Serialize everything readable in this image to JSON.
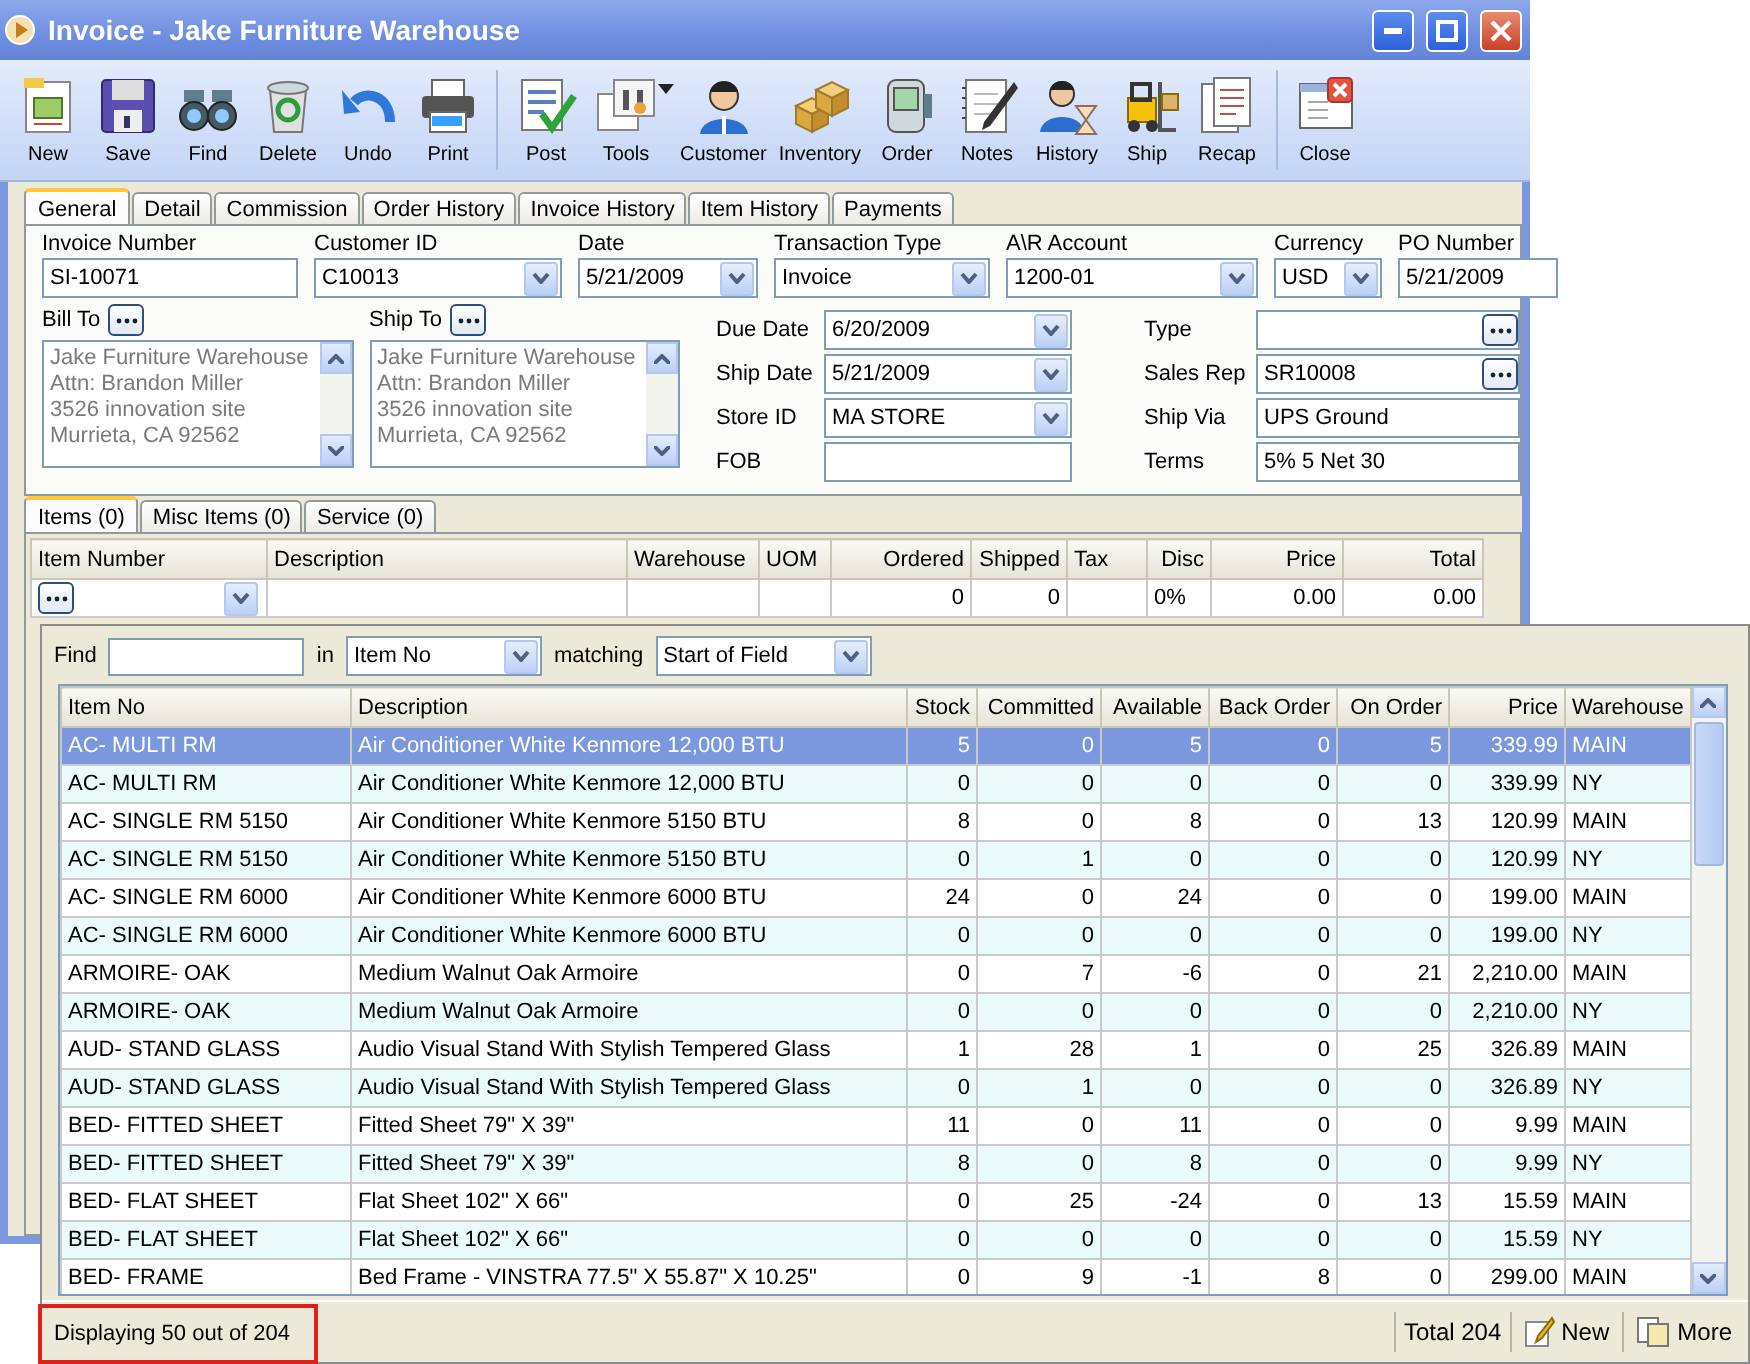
{
  "window": {
    "title": "Invoice - Jake Furniture Warehouse"
  },
  "toolbar": [
    [
      {
        "label": "New"
      },
      {
        "label": "Save"
      },
      {
        "label": "Find"
      },
      {
        "label": "Delete"
      },
      {
        "label": "Undo"
      },
      {
        "label": "Print"
      }
    ],
    [
      {
        "label": "Post"
      },
      {
        "label": "Tools",
        "has_menu": true
      },
      {
        "label": "Customer"
      },
      {
        "label": "Inventory"
      },
      {
        "label": "Order"
      },
      {
        "label": "Notes"
      },
      {
        "label": "History"
      },
      {
        "label": "Ship"
      },
      {
        "label": "Recap"
      }
    ],
    [
      {
        "label": "Close"
      }
    ]
  ],
  "tabs": [
    {
      "label": "General",
      "selected": true
    },
    {
      "label": "Detail",
      "selected": false
    },
    {
      "label": "Commission",
      "selected": false
    },
    {
      "label": "Order History",
      "selected": false
    },
    {
      "label": "Invoice History",
      "selected": false
    },
    {
      "label": "Item History",
      "selected": false
    },
    {
      "label": "Payments",
      "selected": false
    }
  ],
  "header_fields": [
    {
      "label": "Invoice Number",
      "value": "SI-10071",
      "kind": "text"
    },
    {
      "label": "Customer ID",
      "value": "C10013",
      "kind": "dropdown"
    },
    {
      "label": "Date",
      "value": "5/21/2009",
      "kind": "dropdown"
    },
    {
      "label": "Transaction Type",
      "value": "Invoice",
      "kind": "dropdown"
    },
    {
      "label": "A\\R Account",
      "value": "1200-01",
      "kind": "dropdown"
    },
    {
      "label": "Currency",
      "value": "USD",
      "kind": "dropdown"
    },
    {
      "label": "PO Number",
      "value": "5/21/2009",
      "kind": "text"
    }
  ],
  "addresses": [
    {
      "label": "Bill To",
      "lines": [
        "Jake Furniture Warehouse",
        "Attn: Brandon Miller",
        "3526 innovation site",
        "Murrieta, CA 92562"
      ]
    },
    {
      "label": "Ship To",
      "lines": [
        "Jake Furniture Warehouse",
        "Attn: Brandon Miller",
        "3526 innovation site",
        "Murrieta, CA 92562"
      ]
    }
  ],
  "middle_fields": [
    {
      "label": "Due Date",
      "value": "6/20/2009",
      "kind": "dropdown"
    },
    {
      "label": "Ship Date",
      "value": "5/21/2009",
      "kind": "dropdown"
    },
    {
      "label": "Store ID",
      "value": "MA STORE",
      "kind": "dropdown"
    },
    {
      "label": "FOB",
      "kind": "text"
    }
  ],
  "right_fields": [
    {
      "label": "Type",
      "kind": "lookup"
    },
    {
      "label": "Sales Rep",
      "value": "SR10008",
      "kind": "lookup"
    },
    {
      "label": "Ship Via",
      "value": "UPS Ground",
      "kind": "text"
    },
    {
      "label": "Terms",
      "value": "5% 5 Net 30",
      "kind": "text"
    }
  ],
  "item_tabs": [
    {
      "label": "Items (0)",
      "selected": true
    },
    {
      "label": "Misc Items (0)",
      "selected": false
    },
    {
      "label": "Service (0)",
      "selected": false
    }
  ],
  "items_grid": {
    "columns": [
      {
        "label": "Item Number"
      },
      {
        "label": "Description"
      },
      {
        "label": "Warehouse"
      },
      {
        "label": "UOM"
      },
      {
        "label": "Ordered"
      },
      {
        "label": "Shipped"
      },
      {
        "label": "Tax"
      },
      {
        "label": "Disc"
      },
      {
        "label": "Price"
      },
      {
        "label": "Total"
      }
    ],
    "entry_row": {
      "ordered": "0",
      "shipped": "0",
      "disc": "0%",
      "price": "0.00",
      "total": "0.00"
    }
  },
  "lookup_popup": {
    "find_label": "Find",
    "in_label": "in",
    "in_value": "Item No",
    "matching_label": "matching",
    "matching_value": "Start of Field",
    "columns": [
      {
        "label": "Item No"
      },
      {
        "label": "Description"
      },
      {
        "label": "Stock"
      },
      {
        "label": "Committed"
      },
      {
        "label": "Available"
      },
      {
        "label": "Back Order"
      },
      {
        "label": "On Order"
      },
      {
        "label": "Price"
      },
      {
        "label": "Warehouse"
      }
    ],
    "rows": [
      {
        "selected": true,
        "cells": [
          "AC- MULTI RM",
          "Air Conditioner White Kenmore 12,000 BTU",
          "5",
          "0",
          "5",
          "0",
          "5",
          "339.99",
          "MAIN"
        ]
      },
      {
        "selected": false,
        "cells": [
          "AC- MULTI RM",
          "Air Conditioner White Kenmore 12,000 BTU",
          "0",
          "0",
          "0",
          "0",
          "0",
          "339.99",
          "NY"
        ]
      },
      {
        "selected": false,
        "cells": [
          "AC- SINGLE RM 5150",
          "Air Conditioner White Kenmore 5150 BTU",
          "8",
          "0",
          "8",
          "0",
          "13",
          "120.99",
          "MAIN"
        ]
      },
      {
        "selected": false,
        "cells": [
          "AC- SINGLE RM 5150",
          "Air Conditioner White Kenmore 5150 BTU",
          "0",
          "1",
          "0",
          "0",
          "0",
          "120.99",
          "NY"
        ]
      },
      {
        "selected": false,
        "cells": [
          "AC- SINGLE RM 6000",
          "Air Conditioner White Kenmore 6000 BTU",
          "24",
          "0",
          "24",
          "0",
          "0",
          "199.00",
          "MAIN"
        ]
      },
      {
        "selected": false,
        "cells": [
          "AC- SINGLE RM 6000",
          "Air Conditioner White Kenmore 6000 BTU",
          "0",
          "0",
          "0",
          "0",
          "0",
          "199.00",
          "NY"
        ]
      },
      {
        "selected": false,
        "cells": [
          "ARMOIRE- OAK",
          "Medium Walnut Oak Armoire",
          "0",
          "7",
          "-6",
          "0",
          "21",
          "2,210.00",
          "MAIN"
        ]
      },
      {
        "selected": false,
        "cells": [
          "ARMOIRE- OAK",
          "Medium Walnut Oak Armoire",
          "0",
          "0",
          "0",
          "0",
          "0",
          "2,210.00",
          "NY"
        ]
      },
      {
        "selected": false,
        "cells": [
          "AUD- STAND GLASS",
          "Audio Visual Stand With Stylish Tempered Glass",
          "1",
          "28",
          "1",
          "0",
          "25",
          "326.89",
          "MAIN"
        ]
      },
      {
        "selected": false,
        "cells": [
          "AUD- STAND GLASS",
          "Audio Visual Stand With Stylish Tempered Glass",
          "0",
          "1",
          "0",
          "0",
          "0",
          "326.89",
          "NY"
        ]
      },
      {
        "selected": false,
        "cells": [
          "BED- FITTED SHEET",
          "Fitted Sheet 79\" X 39\"",
          "11",
          "0",
          "11",
          "0",
          "0",
          "9.99",
          "MAIN"
        ]
      },
      {
        "selected": false,
        "cells": [
          "BED- FITTED SHEET",
          "Fitted Sheet 79\" X 39\"",
          "8",
          "0",
          "8",
          "0",
          "0",
          "9.99",
          "NY"
        ]
      },
      {
        "selected": false,
        "cells": [
          "BED- FLAT SHEET",
          "Flat Sheet 102\" X 66\"",
          "0",
          "25",
          "-24",
          "0",
          "13",
          "15.59",
          "MAIN"
        ]
      },
      {
        "selected": false,
        "cells": [
          "BED- FLAT SHEET",
          "Flat Sheet 102\" X 66\"",
          "0",
          "0",
          "0",
          "0",
          "0",
          "15.59",
          "NY"
        ]
      },
      {
        "selected": false,
        "cells": [
          "BED- FRAME",
          "Bed Frame - VINSTRA 77.5\" X 55.87\" X 10.25\"",
          "0",
          "9",
          "-1",
          "8",
          "0",
          "299.00",
          "MAIN"
        ]
      }
    ],
    "status": "Displaying 50 out of 204",
    "total": "Total 204",
    "buttons": [
      {
        "label": "New"
      },
      {
        "label": "More"
      }
    ]
  }
}
